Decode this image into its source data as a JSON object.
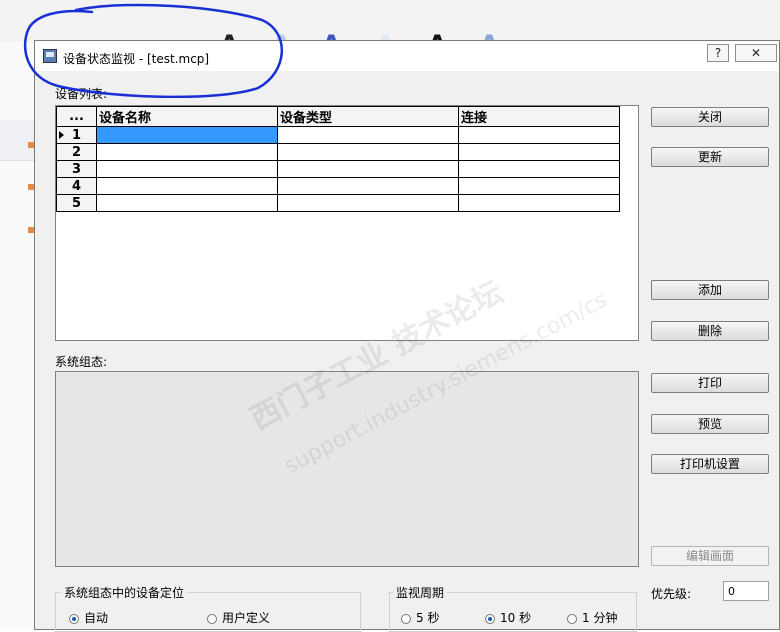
{
  "dialog": {
    "title": "设备状态监视 - [test.mcp]",
    "help_label": "?",
    "close_label": "✕"
  },
  "device_list": {
    "label": "设备列表:",
    "corner_header": "...",
    "columns": [
      "设备名称",
      "设备类型",
      "连接"
    ],
    "rows": [
      {
        "num": "1",
        "name": "",
        "type": "",
        "conn": ""
      },
      {
        "num": "2",
        "name": "",
        "type": "",
        "conn": ""
      },
      {
        "num": "3",
        "name": "",
        "type": "",
        "conn": ""
      },
      {
        "num": "4",
        "name": "",
        "type": "",
        "conn": ""
      },
      {
        "num": "5",
        "name": "",
        "type": "",
        "conn": ""
      }
    ]
  },
  "system_config": {
    "label": "系统组态:"
  },
  "buttons": {
    "close": "关闭",
    "update": "更新",
    "add": "添加",
    "delete": "删除",
    "print": "打印",
    "preview": "预览",
    "printer_setup": "打印机设置",
    "edit_screen": "编辑画面"
  },
  "positioning": {
    "label": "系统组态中的设备定位",
    "options": [
      "自动",
      "用户定义"
    ],
    "selected": "自动"
  },
  "monitor_cycle": {
    "label": "监视周期",
    "options": [
      "5 秒",
      "10 秒",
      "1 分钟"
    ],
    "selected": "10 秒"
  },
  "priority": {
    "label": "优先级:",
    "value": "0"
  },
  "watermark": {
    "line1": "西门子工业 技术论坛",
    "line2": "support.industry.siemens.com/cs"
  },
  "colors": {
    "selection": "#3399ff",
    "annotation": "#1a2fd6"
  }
}
